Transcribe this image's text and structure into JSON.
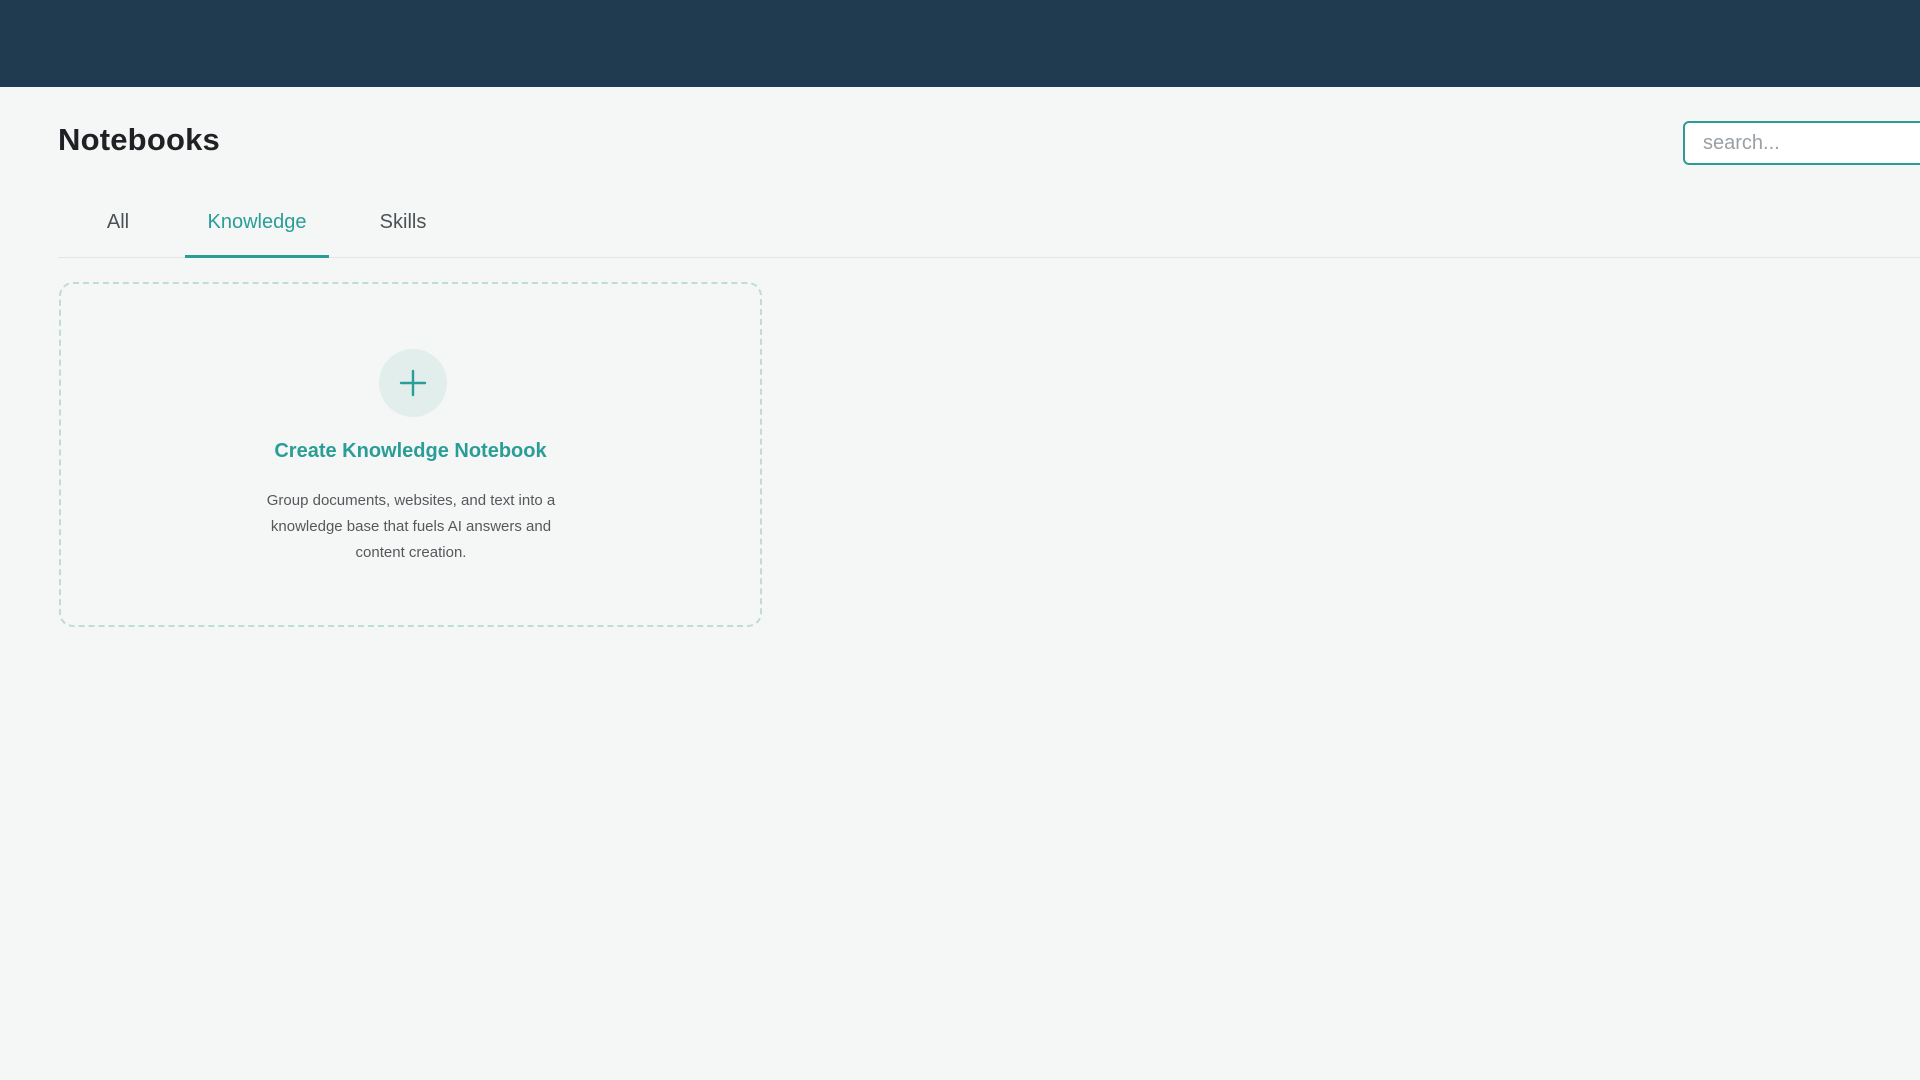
{
  "header": {
    "title": "Notebooks"
  },
  "search": {
    "placeholder": "search...",
    "value": ""
  },
  "tabs": [
    {
      "label": "All",
      "active": false
    },
    {
      "label": "Knowledge",
      "active": true
    },
    {
      "label": "Skills",
      "active": false
    }
  ],
  "create_card": {
    "icon": "plus-icon",
    "title": "Create Knowledge Notebook",
    "description": "Group documents, websites, and text into a knowledge base that fuels AI answers and content creation."
  },
  "colors": {
    "topbar": "#203a4f",
    "accent": "#2a9d97",
    "background": "#f5f6f6"
  }
}
